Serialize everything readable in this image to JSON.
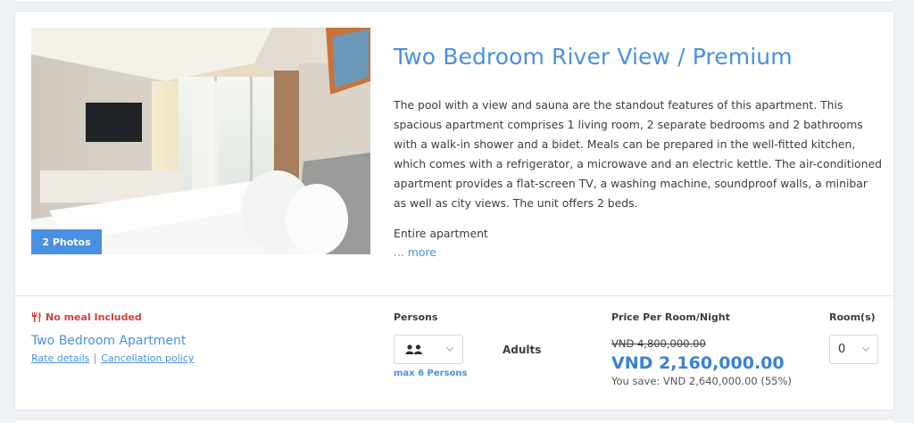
{
  "room": {
    "title": "Two Bedroom River View / Premium",
    "description": "The pool with a view and sauna are the standout features of this apartment. This spacious apartment comprises 1 living room, 2 separate bedrooms and 2 bathrooms with a walk-in shower and a bidet. Meals can be prepared in the well-fitted kitchen, which comes with a refrigerator, a microwave and an electric kettle. The air-conditioned apartment provides a flat-screen TV, a washing machine, soundproof walls, a minibar as well as city views. The unit offers 2 beds.",
    "unit_type": "Entire apartment",
    "more_label": "... more",
    "photos_label": "2 Photos"
  },
  "rate": {
    "meal_label": "No meal Included",
    "meal_icon": "utensils-icon",
    "meal_color": "#e03a3a",
    "apartment_name": "Two Bedroom Apartment",
    "rate_details_label": "Rate details",
    "cancellation_label": "Cancellation policy"
  },
  "persons": {
    "header": "Persons",
    "icon": "two-users-icon",
    "max_label": "max 6 Persons",
    "adults_label": "Adults"
  },
  "price": {
    "header": "Price Per Room/Night",
    "original": "VND 4,800,000.00",
    "current": "VND 2,160,000.00",
    "savings": "You save: VND 2,640,000.00 (55%)"
  },
  "rooms": {
    "header": "Room(s)",
    "selected": "0"
  },
  "colors": {
    "accent": "#4a90e2",
    "warning": "#e03a3a"
  }
}
